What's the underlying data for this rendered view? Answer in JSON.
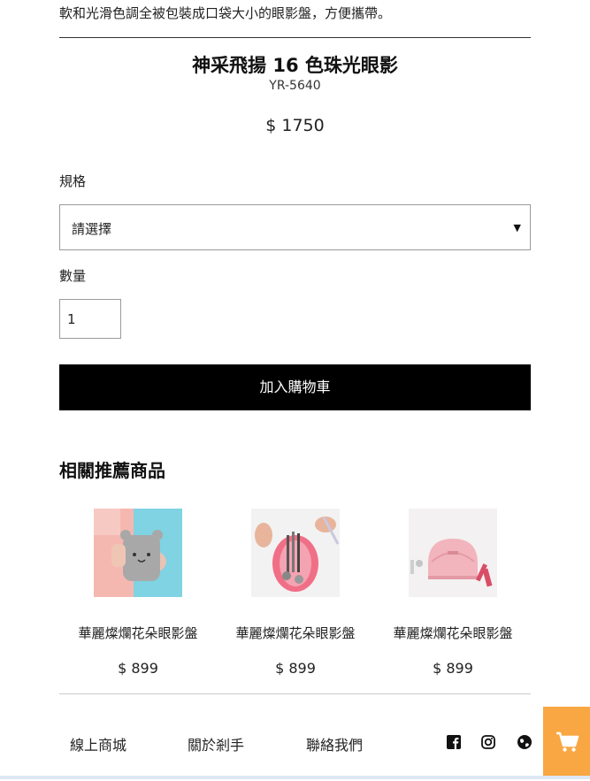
{
  "description": "軟和光滑色調全被包裝成口袋大小的眼影盤，方便攜帶。",
  "product": {
    "title": "神采飛揚 16 色珠光眼影",
    "sku": "YR-5640",
    "price": "$ 1750"
  },
  "spec": {
    "label": "規格",
    "selected": "請選擇"
  },
  "quantity": {
    "label": "數量",
    "value": "1"
  },
  "add_to_cart": "加入購物車",
  "related": {
    "heading": "相關推薦商品",
    "items": [
      {
        "name": "華麗燦爛花朵眼影盤",
        "price": "$ 899",
        "image": "gray-bunny-pouch-photo"
      },
      {
        "name": "華麗燦爛花朵眼影盤",
        "price": "$ 899",
        "image": "pink-pouch-with-brushes-photo"
      },
      {
        "name": "華麗燦爛花朵眼影盤",
        "price": "$ 899",
        "image": "pink-dome-cosmetic-bag-photo"
      }
    ]
  },
  "footer": {
    "links": [
      "線上商城",
      "關於剎手",
      "聯絡我們"
    ],
    "social_icons": [
      "facebook-icon",
      "instagram-icon",
      "globe-icon"
    ]
  },
  "floating_cart": {
    "icon": "cart-icon",
    "color": "#f8a742"
  }
}
